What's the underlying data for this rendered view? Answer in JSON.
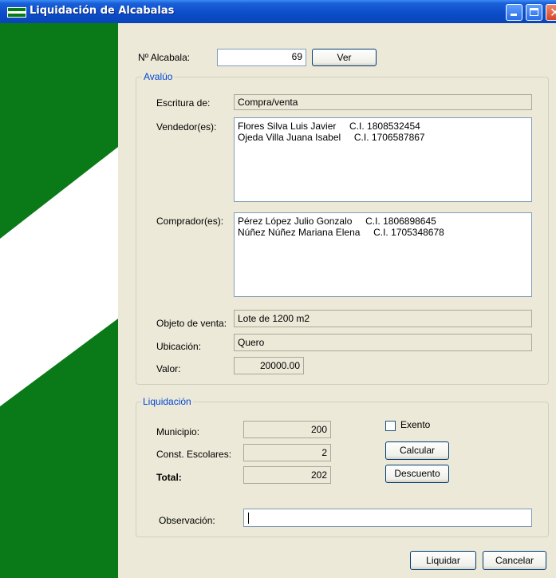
{
  "window": {
    "title": "Liquidación de Alcabalas",
    "icon": "flag-icon",
    "controls": [
      "minimize-icon",
      "maximize-icon",
      "close-icon"
    ],
    "colors": {
      "titlebar": "#0b4cc8",
      "flag_green": "#0a7a18",
      "legend_blue": "#0046d5",
      "background": "#ece9d8"
    }
  },
  "alcabala": {
    "label": "Nº Alcabala:",
    "value": "69",
    "ver_button": "Ver"
  },
  "avaluo": {
    "legend": "Avalúo",
    "escritura_label": "Escritura de:",
    "escritura_value": "Compra/venta",
    "vendedores_label": "Vendedor(es):",
    "vendedores": [
      "Flores Silva Luis Javier     C.I. 1808532454",
      "Ojeda Villa Juana Isabel     C.I. 1706587867"
    ],
    "compradores_label": "Comprador(es):",
    "compradores": [
      "Pérez López Julio Gonzalo     C.I. 1806898645",
      "Núñez Núñez Mariana Elena     C.I. 1705348678"
    ],
    "objeto_label": "Objeto de venta:",
    "objeto_value": "Lote de 1200 m2",
    "ubicacion_label": "Ubicación:",
    "ubicacion_value": "Quero",
    "valor_label": "Valor:",
    "valor_value": "20000.00"
  },
  "liquidacion": {
    "legend": "Liquidación",
    "municipio_label": "Municipio:",
    "municipio_value": "200",
    "const_label": "Const. Escolares:",
    "const_value": "2",
    "total_label": "Total:",
    "total_value": "202",
    "exento_label": "Exento",
    "exento_checked": false,
    "calcular_button": "Calcular",
    "descuento_button": "Descuento",
    "observacion_label": "Observación:",
    "observacion_value": ""
  },
  "footer": {
    "liquidar_button": "Liquidar",
    "cancelar_button": "Cancelar"
  }
}
